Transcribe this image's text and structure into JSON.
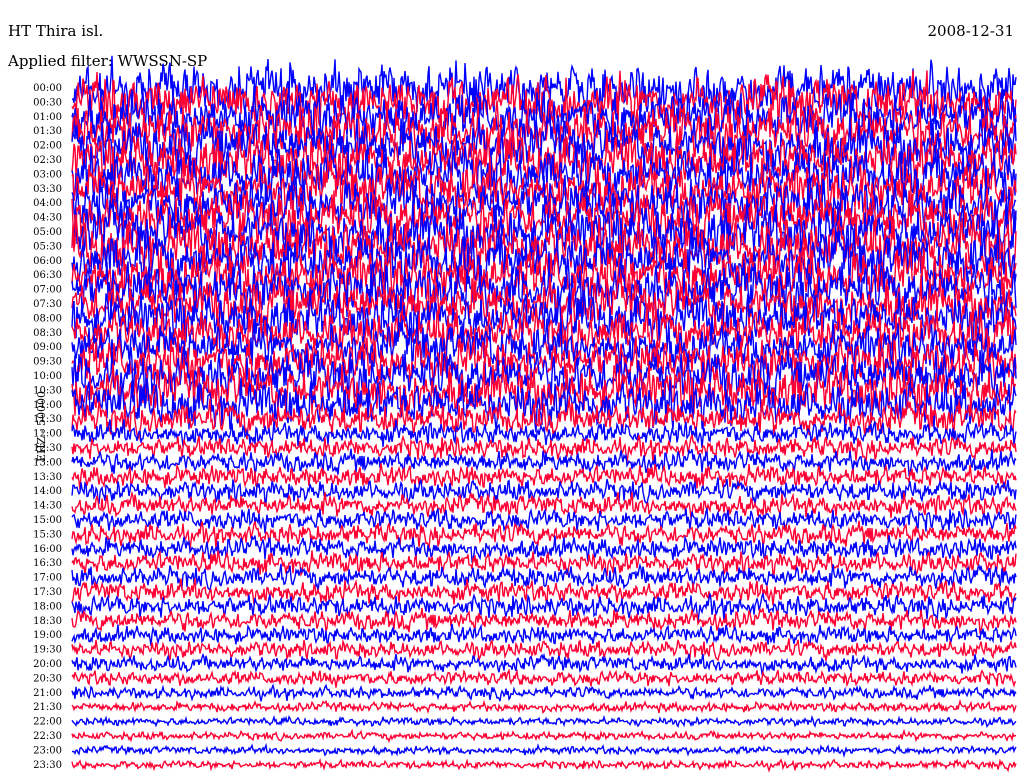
{
  "header": {
    "station": "HT Thira isl.",
    "date": "2008-12-31",
    "filter": "Applied filter: WWSSN-SP"
  },
  "chart_data": {
    "type": "line",
    "title": "HT Thira isl.",
    "date": "2008-12-31",
    "filter": "WWSSN-SP",
    "ylabel": "EHZ - 50000",
    "grid": false,
    "row_colors": [
      "#0000ff",
      "#ff0033"
    ],
    "row_labels": [
      "00:00",
      "00:30",
      "01:00",
      "01:30",
      "02:00",
      "02:30",
      "03:00",
      "03:30",
      "04:00",
      "04:30",
      "05:00",
      "05:30",
      "06:00",
      "06:30",
      "07:00",
      "07:30",
      "08:00",
      "08:30",
      "09:00",
      "09:30",
      "10:00",
      "10:30",
      "11:00",
      "11:30",
      "12:00",
      "12:30",
      "13:00",
      "13:30",
      "14:00",
      "14:30",
      "15:00",
      "15:30",
      "16:00",
      "16:30",
      "17:00",
      "17:30",
      "18:00",
      "18:30",
      "19:00",
      "19:30",
      "20:00",
      "20:30",
      "21:00",
      "21:30",
      "22:00",
      "22:30",
      "23:00",
      "23:30"
    ],
    "row_amplitude_relative": [
      1.9,
      1.9,
      1.9,
      1.9,
      1.9,
      1.9,
      1.9,
      1.9,
      1.9,
      1.9,
      2.0,
      2.0,
      2.0,
      2.0,
      1.9,
      1.8,
      1.8,
      1.7,
      1.7,
      1.7,
      1.8,
      1.8,
      1.7,
      1.2,
      0.85,
      0.8,
      0.8,
      0.8,
      0.8,
      0.8,
      0.8,
      0.8,
      0.8,
      0.8,
      0.8,
      0.8,
      0.8,
      0.75,
      0.65,
      0.65,
      0.6,
      0.55,
      0.45,
      0.35,
      0.3,
      0.3,
      0.3,
      0.3
    ]
  }
}
